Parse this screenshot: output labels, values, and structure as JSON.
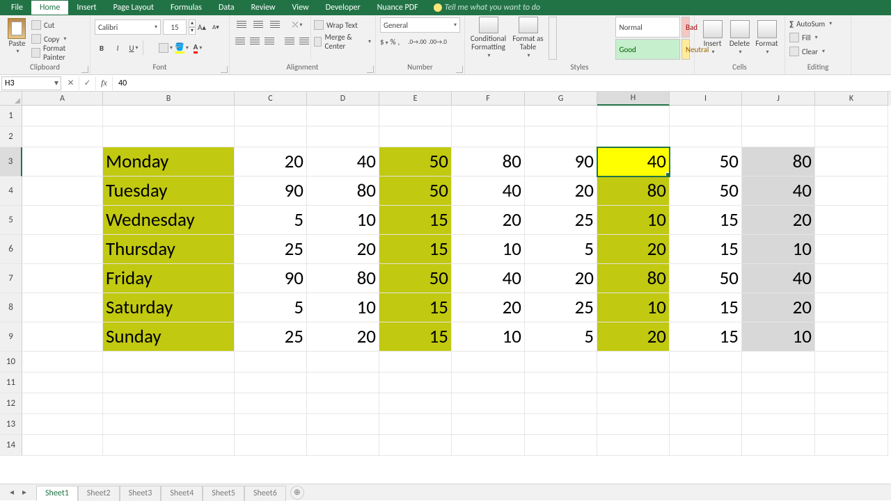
{
  "menu": {
    "file": "File",
    "home": "Home",
    "insert": "Insert",
    "page_layout": "Page Layout",
    "formulas": "Formulas",
    "data": "Data",
    "review": "Review",
    "view": "View",
    "developer": "Developer",
    "nuance": "Nuance PDF",
    "tell": "Tell me what you want to do"
  },
  "ribbon": {
    "clipboard": {
      "title": "Clipboard",
      "paste": "Paste",
      "cut": "Cut",
      "copy": "Copy",
      "format_painter": "Format Painter"
    },
    "font": {
      "title": "Font",
      "name": "Calibri",
      "size": "15",
      "bold": "B",
      "italic": "I",
      "underline": "U"
    },
    "alignment": {
      "title": "Alignment",
      "wrap": "Wrap Text",
      "merge": "Merge & Center"
    },
    "number": {
      "title": "Number",
      "format": "General"
    },
    "styles": {
      "title": "Styles",
      "cf": "Conditional Formatting",
      "fat": "Format as Table",
      "normal": "Normal",
      "bad": "Bad",
      "good": "Good",
      "neutral": "Neutral"
    },
    "cells": {
      "title": "Cells",
      "insert": "Insert",
      "delete": "Delete",
      "format": "Format"
    },
    "editing": {
      "title": "Editing",
      "autosum": "AutoSum",
      "fill": "Fill",
      "clear": "Clear"
    }
  },
  "formula_bar": {
    "namebox": "H3",
    "value": "40"
  },
  "columns": [
    "A",
    "B",
    "C",
    "D",
    "E",
    "F",
    "G",
    "H",
    "I",
    "J",
    "K"
  ],
  "col_widths": {
    "A": 116,
    "B": 189,
    "C": 104,
    "D": 104,
    "E": 104,
    "F": 105,
    "G": 104,
    "H": 104,
    "I": 104,
    "J": 105,
    "K": 105
  },
  "row_heights": {
    "small": 30,
    "big": 42
  },
  "selected_cell": "H3",
  "data_rows": [
    {
      "label": "Monday",
      "values": [
        20,
        40,
        50,
        80,
        90,
        40,
        50,
        80
      ]
    },
    {
      "label": "Tuesday",
      "values": [
        90,
        80,
        50,
        40,
        20,
        80,
        50,
        40
      ]
    },
    {
      "label": "Wednesday",
      "values": [
        5,
        10,
        15,
        20,
        25,
        10,
        15,
        20
      ]
    },
    {
      "label": "Thursday",
      "values": [
        25,
        20,
        15,
        10,
        5,
        20,
        15,
        10
      ]
    },
    {
      "label": "Friday",
      "values": [
        90,
        80,
        50,
        40,
        20,
        80,
        50,
        40
      ]
    },
    {
      "label": "Saturday",
      "values": [
        5,
        10,
        15,
        20,
        25,
        10,
        15,
        20
      ]
    },
    {
      "label": "Sunday",
      "values": [
        25,
        20,
        15,
        10,
        5,
        20,
        15,
        10
      ]
    }
  ],
  "sheets": {
    "tabs": [
      "Sheet1",
      "Sheet2",
      "Sheet3",
      "Sheet4",
      "Sheet5",
      "Sheet6"
    ],
    "active": "Sheet1"
  }
}
